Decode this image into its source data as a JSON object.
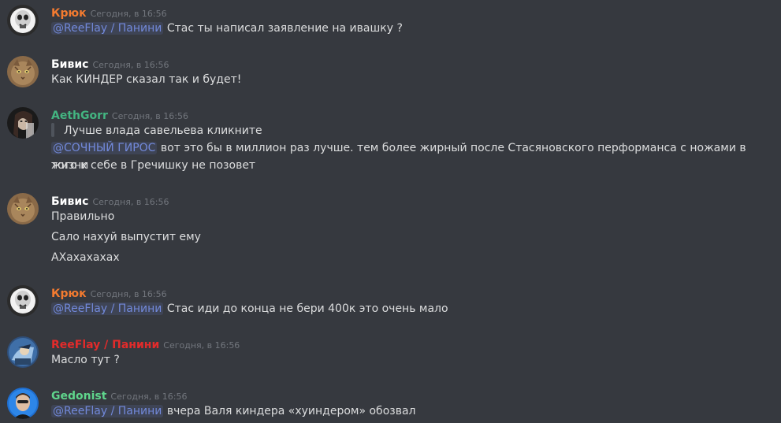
{
  "colors": {
    "background": "#36393f",
    "text": "#dcddde",
    "timestamp": "#72767d",
    "mention": "#7289da",
    "orange": "#f47b30",
    "white": "#ffffff",
    "green_dark": "#43b581",
    "red": "#e32b2b",
    "green_light": "#5fd58c"
  },
  "messages": [
    {
      "author": "Крюк",
      "timestamp": "Сегодня, в 16:56",
      "avatar_icon": "skull-avatar-icon",
      "lines": [
        {
          "mention": "@ReeFlay / Панини",
          "text": "Стас ты написал заявление на ивашку ?"
        }
      ]
    },
    {
      "author": "Бивис",
      "timestamp": "Сегодня, в 16:56",
      "avatar_icon": "cat-avatar-icon",
      "lines": [
        {
          "text": "Как КИНДЕР сказал так и будет!"
        }
      ]
    },
    {
      "author": "AethGorr",
      "timestamp": "Сегодня, в 16:56",
      "avatar_icon": "dark-portrait-avatar-icon",
      "quote": "Лучше влада савельева кликните",
      "lines": [
        {
          "mention": "@СОЧНЫЙ ГИРОС",
          "text": "вот это бы в миллион раз лучше. тем более жирный после Стасяновского перформанса с ножами в жизни"
        },
        {
          "text": "того к себе в Гречишку не позовет"
        }
      ]
    },
    {
      "author": "Бивис",
      "timestamp": "Сегодня, в 16:56",
      "avatar_icon": "cat-avatar-icon",
      "lines": [
        {
          "text": "Правильно"
        },
        {
          "text": "Сало нахуй выпустит ему"
        },
        {
          "text": "АХахахахах"
        }
      ]
    },
    {
      "author": "Крюк",
      "timestamp": "Сегодня, в 16:56",
      "avatar_icon": "skull-avatar-icon",
      "lines": [
        {
          "mention": "@ReeFlay / Панини",
          "text": "Стас иди до конца не бери 400к это очень мало"
        }
      ]
    },
    {
      "author": "ReeFlay / Панини",
      "timestamp": "Сегодня, в 16:56",
      "avatar_icon": "blue-character-avatar-icon",
      "lines": [
        {
          "text": "Масло тут ?"
        }
      ]
    },
    {
      "author": "Gedonist",
      "timestamp": "Сегодня, в 16:56",
      "avatar_icon": "man-portrait-avatar-icon",
      "lines": [
        {
          "mention": "@ReeFlay / Панини",
          "text": "вчера Валя киндера «хуиндером» обозвал"
        }
      ]
    }
  ]
}
